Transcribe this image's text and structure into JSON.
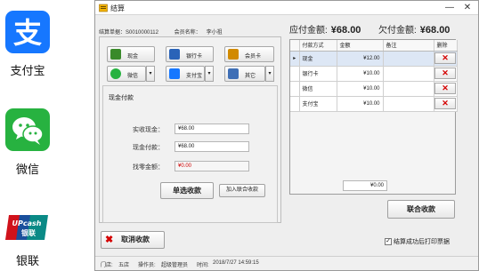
{
  "brands": [
    {
      "icon": "alipay-logo-icon",
      "label": "支付宝",
      "color": "#1677ff"
    },
    {
      "icon": "wechat-logo-icon",
      "label": "微信",
      "color": "#27b240"
    },
    {
      "icon": "unionpay-logo-icon",
      "label": "银联",
      "color": "#d0121b",
      "logo_text_top": "UPcash",
      "logo_text_bottom": "银联"
    }
  ],
  "window": {
    "title": "结算",
    "minimize": "—",
    "close": "✕"
  },
  "info": {
    "order_label": "结算单据：",
    "order_no": "S0010000112",
    "member_label": "会员名称：",
    "member_name": "李小祖"
  },
  "amounts": {
    "payable_label": "应付金额:",
    "payable_value": "¥68.00",
    "owed_label": "欠付金额:",
    "owed_value": "¥68.00"
  },
  "pay_methods": [
    {
      "label": "现金",
      "icon": "cash-icon",
      "color": "#3a8a2a"
    },
    {
      "label": "银行卡",
      "icon": "bank-card-icon",
      "color": "#2a63b8"
    },
    {
      "label": "会员卡",
      "icon": "member-card-icon",
      "color": "#d18a00"
    },
    {
      "label": "微信",
      "icon": "wechat-pay-icon",
      "color": "#27b240"
    },
    {
      "label": "支付宝",
      "icon": "alipay-pay-icon",
      "color": "#1677ff"
    },
    {
      "label": "其它",
      "icon": "other-pay-icon",
      "color": "#3f6fb6"
    }
  ],
  "cash_form": {
    "title": "现金付款",
    "received_label": "实收现金：",
    "received_value": "¥68.00",
    "cash_pay_label": "现金付款：",
    "cash_pay_value": "¥68.00",
    "change_label": "找零金额：",
    "change_value": "¥0.00",
    "single_btn": "单选收款",
    "add_btn": "加入联合收款"
  },
  "grid": {
    "columns": [
      "付款方式",
      "金额",
      "备注",
      "删除"
    ],
    "rows": [
      {
        "method": "现金",
        "amount": "¥12.00",
        "note": ""
      },
      {
        "method": "银行卡",
        "amount": "¥10.00",
        "note": ""
      },
      {
        "method": "微信",
        "amount": "¥10.00",
        "note": ""
      },
      {
        "method": "支付宝",
        "amount": "¥10.00",
        "note": ""
      }
    ],
    "delete_glyph": "✕",
    "row_marker": "▸",
    "total": "¥0.00"
  },
  "union_btn": "联合收款",
  "cancel_btn": "取消收款",
  "print_checkbox": {
    "label": "结算成功后打印票据",
    "checked": true
  },
  "status": {
    "store_label": "门店:",
    "store": "五店",
    "operator_label": "操作员:",
    "operator": "超级管理员",
    "time_label": "时间:",
    "time": "2018/7/27 14:59:15"
  }
}
